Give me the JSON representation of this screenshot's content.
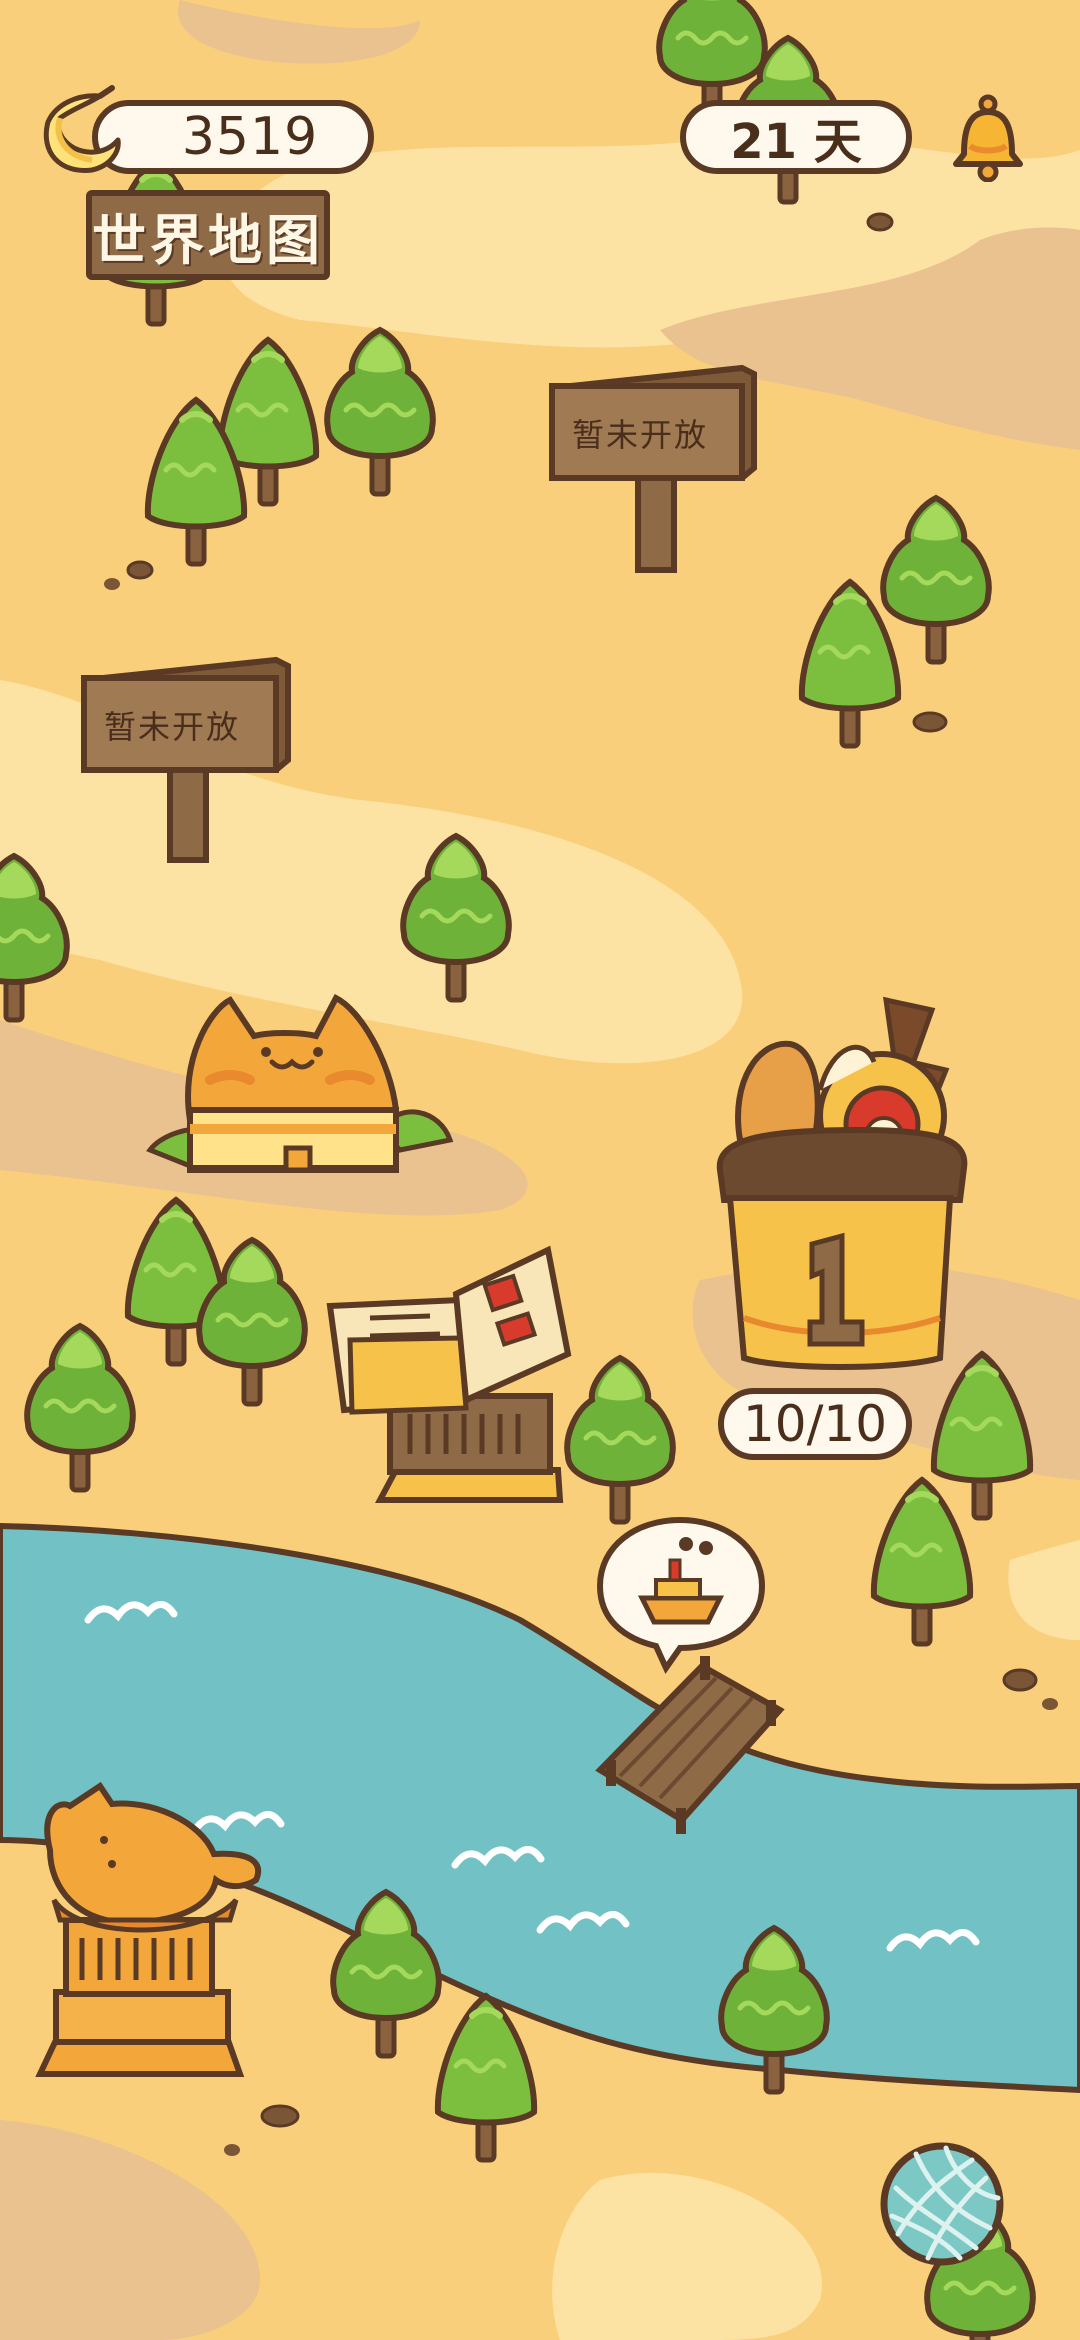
{
  "hud": {
    "coins": "3519",
    "days": "21 天",
    "title": "世界地图",
    "icons": [
      "banana-icon",
      "bell-icon",
      "yarn-ball-icon"
    ]
  },
  "map": {
    "locked_sign_1": "暂未开放",
    "locked_sign_2": "暂未开放",
    "level_badge_number": "1",
    "level_progress": "10/10",
    "dock_bubble_icon": "ship-icon"
  },
  "colors": {
    "sand": "#F9CF7B",
    "sand_light": "#FDE3A3",
    "sand_dark": "#E9C290",
    "river": "#72C1C5",
    "outline": "#5A3A24",
    "tree": "#7CBF3E",
    "tree_light": "#A5D95C",
    "wood": "#8E6A46",
    "cat_orange": "#F3A63A"
  }
}
